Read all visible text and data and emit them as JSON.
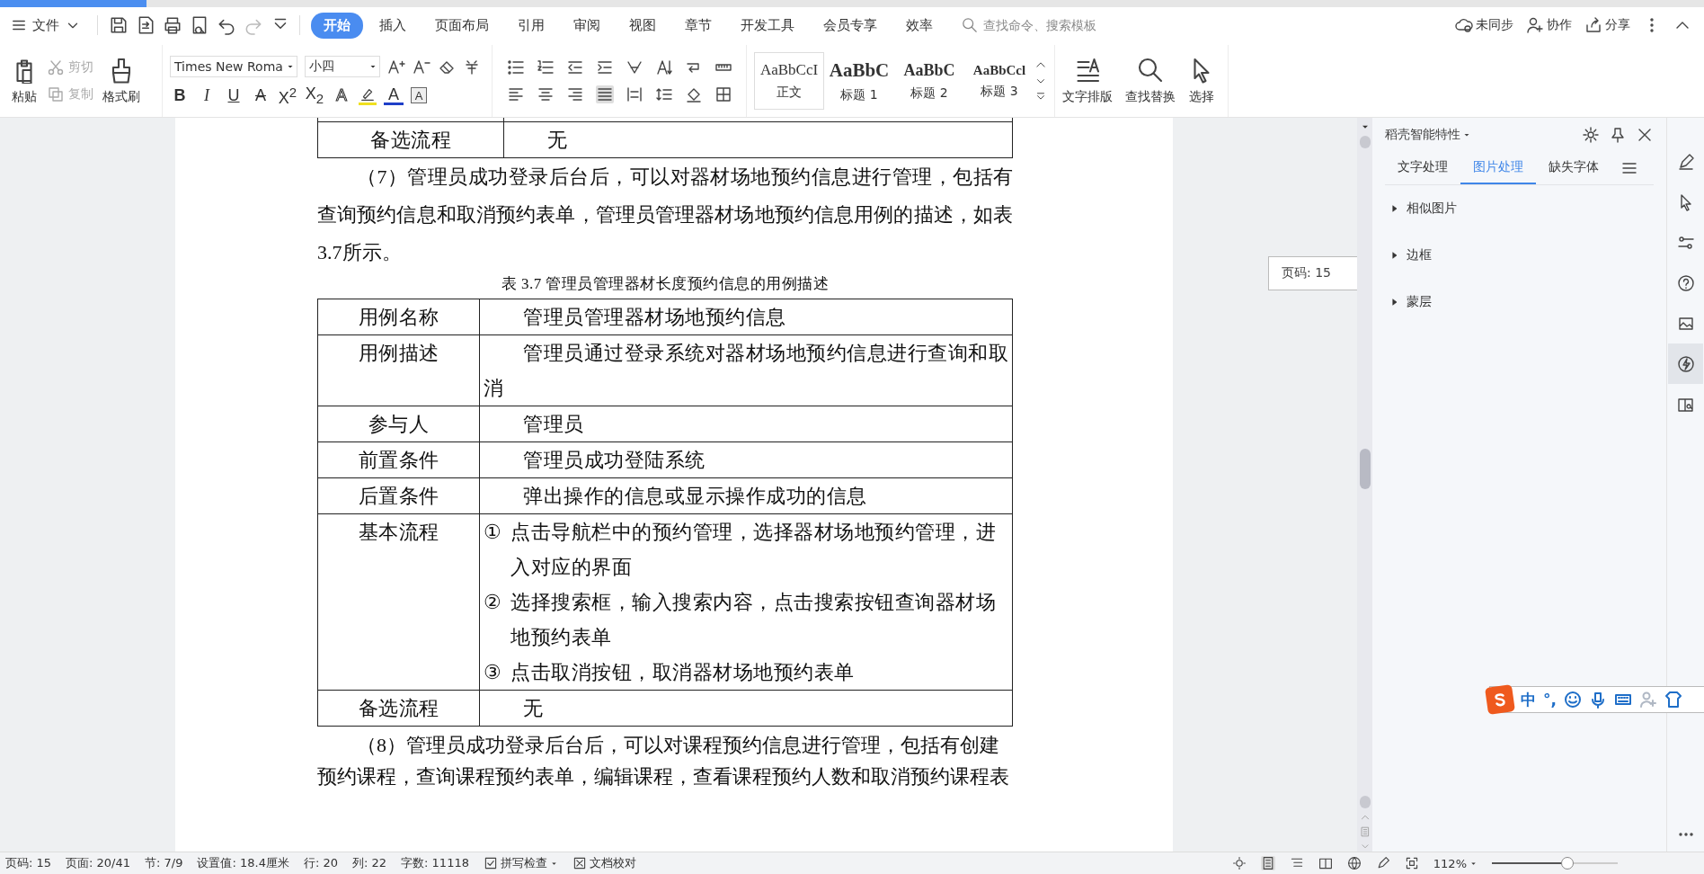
{
  "menu_bar": {
    "file_menu": "文件",
    "tabs": [
      {
        "label": "开始",
        "selected": true
      },
      {
        "label": "插入",
        "selected": false
      },
      {
        "label": "页面布局",
        "selected": false
      },
      {
        "label": "引用",
        "selected": false
      },
      {
        "label": "审阅",
        "selected": false
      },
      {
        "label": "视图",
        "selected": false
      },
      {
        "label": "章节",
        "selected": false
      },
      {
        "label": "开发工具",
        "selected": false
      },
      {
        "label": "会员专享",
        "selected": false
      },
      {
        "label": "效率",
        "selected": false
      }
    ],
    "search": {
      "placeholder": "查找命令、搜索模板"
    },
    "actions": [
      {
        "label": "未同步"
      },
      {
        "label": "协作"
      },
      {
        "label": "分享"
      }
    ]
  },
  "ribbon": {
    "clipboard": [
      {
        "label": "粘贴",
        "kind": "large",
        "disabled": false
      },
      {
        "label": "剪切",
        "kind": "small",
        "disabled": true
      },
      {
        "label": "复制",
        "kind": "small",
        "disabled": true
      },
      {
        "label": "格式刷",
        "kind": "large",
        "disabled": false
      }
    ],
    "font_name": "Times New Roma",
    "font_size": "小四",
    "format_buttons": [
      {
        "label": "B",
        "kind": "bold"
      },
      {
        "label": "I",
        "kind": "italic"
      },
      {
        "label": "U",
        "kind": "underline"
      },
      {
        "label": "A",
        "kind": "strike"
      },
      {
        "label": "X$^{2}$",
        "kind": "plain"
      },
      {
        "label": "X$_{2}$",
        "kind": "plain"
      },
      {
        "label": "A",
        "kind": "outline"
      },
      {
        "label": "A",
        "kind": "color"
      },
      {
        "label": "A",
        "kind": "boxed"
      }
    ],
    "styles": [
      {
        "preview": "AaBbCcI",
        "label": "正文",
        "kind": "normal",
        "selected": true
      },
      {
        "preview": "AaBbC",
        "label": "标题 1",
        "kind": "h1",
        "selected": false
      },
      {
        "preview": "AaBbC",
        "label": "标题 2",
        "kind": "h2",
        "selected": false
      },
      {
        "preview": "AaBbCcl",
        "label": "标题 3",
        "kind": "h3",
        "selected": false
      }
    ],
    "tools": [
      {
        "label": "文字排版"
      },
      {
        "label": "查找替换"
      },
      {
        "label": "选择"
      }
    ]
  },
  "document": {
    "blocks": [
      {
        "kind": "table",
        "rows": [
          {
            "label": "",
            "value": ""
          },
          {
            "label": "备选流程",
            "value": "无"
          }
        ]
      },
      {
        "kind": "paragraph",
        "text": "（7）管理员成功登录后台后，可以对器材场地预约信息进行管理，包括有查询预约信息和取消预约表单，管理员管理器材场地预约信息用例的描述，如表3.7所示。"
      },
      {
        "kind": "caption",
        "text": "表 3.7  管理员管理器材长度预约信息的用例描述"
      },
      {
        "kind": "table",
        "rows": [
          {
            "label": "用例名称",
            "value": "管理员管理器材场地预约信息"
          },
          {
            "label": "用例描述",
            "value": "管理员通过登录系统对器材场地预约信息进行查询和取消"
          },
          {
            "label": "参与人",
            "value": "管理员"
          },
          {
            "label": "前置条件",
            "value": "管理员成功登陆系统"
          },
          {
            "label": "后置条件",
            "value": "弹出操作的信息或显示操作成功的信息"
          },
          {
            "label": "基本流程",
            "steps": [
              {
                "mark": "①",
                "text": "点击导航栏中的预约管理，选择器材场地预约管理，进入对应的界面"
              },
              {
                "mark": "②",
                "text": "选择搜索框，输入搜索内容，点击搜索按钮查询器材场地预约表单"
              },
              {
                "mark": "③",
                "text": "点击取消按钮，取消器材场地预约表单"
              }
            ]
          },
          {
            "label": "备选流程",
            "value": "无"
          }
        ]
      },
      {
        "kind": "paragraph",
        "text": "（8）管理员成功登录后台后，可以对课程预约信息进行管理，包括有创建"
      },
      {
        "kind": "line",
        "text": "预约课程，查询课程预约表单，编辑课程，查看课程预约人数和取消预约课程表"
      }
    ]
  },
  "page_tooltip": "页码: 15",
  "side_panel": {
    "title": "稻壳智能特性",
    "tabs": [
      {
        "label": "文字处理",
        "selected": false
      },
      {
        "label": "图片处理",
        "selected": true
      },
      {
        "label": "缺失字体",
        "selected": false
      }
    ],
    "items": [
      {
        "label": "相似图片",
        "expanded": false
      },
      {
        "label": "边框",
        "expanded": false
      },
      {
        "label": "蒙层",
        "expanded": false
      }
    ]
  },
  "icon_strip": [
    {
      "selected": false
    },
    {
      "selected": false
    },
    {
      "selected": false
    },
    {
      "selected": false
    },
    {
      "selected": false
    },
    {
      "selected": true
    },
    {
      "selected": false
    }
  ],
  "ime_toolbar": {
    "mode": "中",
    "punctuation": "°,"
  },
  "status_bar": {
    "items": [
      "页码: 15",
      "页面: 20/41",
      "节: 7/9",
      "设置值: 18.4厘米",
      "行: 20",
      "列: 22",
      "字数: 11118"
    ],
    "checks": [
      {
        "label": "拼写检查",
        "dropdown": true
      },
      {
        "label": "文档校对",
        "dropdown": false
      }
    ],
    "zoom": "112%",
    "zoom_slider": {
      "level": 0.6
    }
  }
}
